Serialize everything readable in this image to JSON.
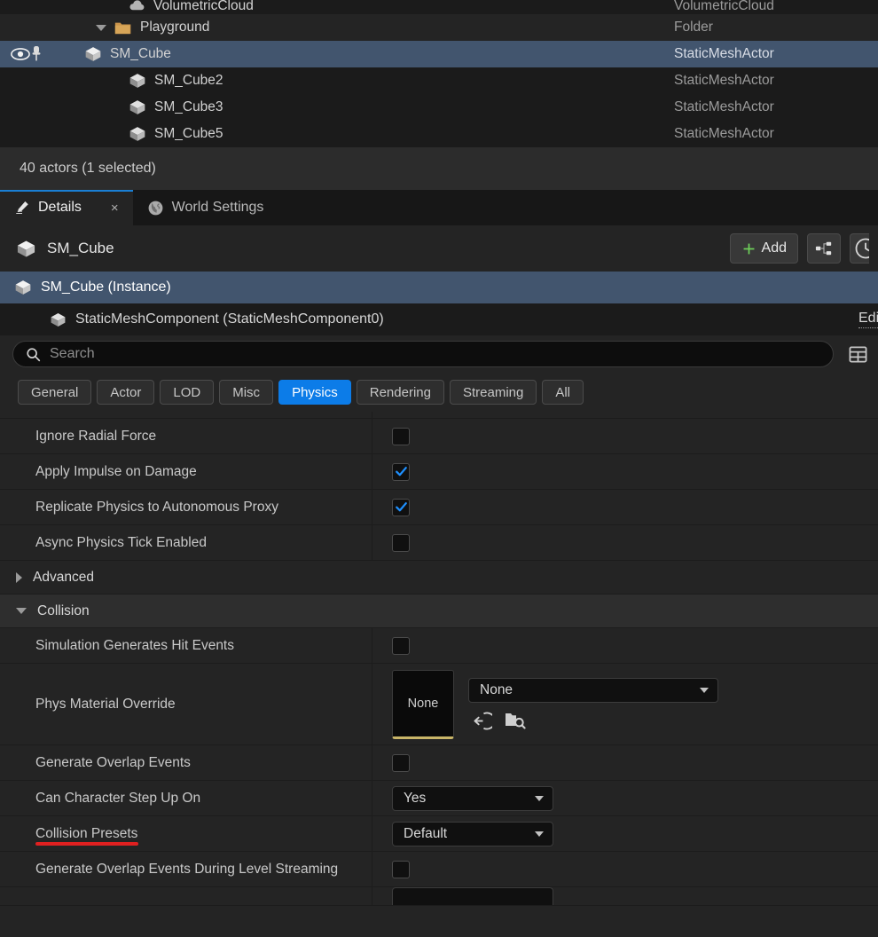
{
  "outliner": {
    "rows": [
      {
        "name": "VolumetricCloud",
        "type": "VolumetricCloud",
        "icon": "cloud-icon",
        "indent": 3,
        "state": "clipped"
      },
      {
        "name": "Playground",
        "type": "Folder",
        "icon": "folder-icon",
        "indent": 2,
        "state": "alt"
      },
      {
        "name": "SM_Cube",
        "type": "StaticMeshActor",
        "icon": "static-mesh-icon",
        "indent": 3,
        "state": "selected"
      },
      {
        "name": "SM_Cube2",
        "type": "StaticMeshActor",
        "icon": "static-mesh-icon",
        "indent": 3,
        "state": "normal"
      },
      {
        "name": "SM_Cube3",
        "type": "StaticMeshActor",
        "icon": "static-mesh-icon",
        "indent": 3,
        "state": "normal"
      },
      {
        "name": "SM_Cube5",
        "type": "StaticMeshActor",
        "icon": "static-mesh-icon",
        "indent": 3,
        "state": "normal"
      }
    ],
    "status": "40 actors (1 selected)"
  },
  "tabs": {
    "details": {
      "label": "Details",
      "icon": "pencil-icon",
      "close": "×"
    },
    "world_settings": {
      "label": "World Settings",
      "icon": "globe-icon"
    }
  },
  "details_header": {
    "title": "SM_Cube",
    "icon": "static-mesh-icon",
    "add_label": "Add",
    "add_icon": "plus-icon",
    "blueprint_icon": "hierarchy-icon",
    "history_icon": "clock-icon"
  },
  "component_tree": {
    "rows": [
      {
        "label": "SM_Cube (Instance)",
        "icon": "static-mesh-icon",
        "selected": true,
        "edit": ""
      },
      {
        "label": "StaticMeshComponent (StaticMeshComponent0)",
        "icon": "static-mesh-icon",
        "selected": false,
        "edit": "Edit"
      }
    ]
  },
  "search": {
    "placeholder": "Search",
    "value": "",
    "icon": "search-icon",
    "settings_icon": "grid-settings-icon"
  },
  "filters": {
    "items": [
      {
        "label": "General",
        "active": false
      },
      {
        "label": "Actor",
        "active": false
      },
      {
        "label": "LOD",
        "active": false
      },
      {
        "label": "Misc",
        "active": false
      },
      {
        "label": "Physics",
        "active": true
      },
      {
        "label": "Rendering",
        "active": false
      },
      {
        "label": "Streaming",
        "active": false
      },
      {
        "label": "All",
        "active": false
      }
    ]
  },
  "properties": [
    {
      "kind": "checkbox",
      "label": "Ignore Radial Force",
      "checked": false
    },
    {
      "kind": "checkbox",
      "label": "Apply Impulse on Damage",
      "checked": true
    },
    {
      "kind": "checkbox",
      "label": "Replicate Physics to Autonomous Proxy",
      "checked": true
    },
    {
      "kind": "checkbox",
      "label": "Async Physics Tick Enabled",
      "checked": false
    },
    {
      "kind": "section",
      "label": "Advanced",
      "expanded": false
    },
    {
      "kind": "section",
      "label": "Collision",
      "expanded": true
    },
    {
      "kind": "checkbox",
      "label": "Simulation Generates Hit Events",
      "checked": false
    },
    {
      "kind": "asset",
      "label": "Phys Material Override",
      "thumb_label": "None",
      "value": "None",
      "use_icon": "use-selected-asset-icon",
      "browse_icon": "browse-asset-icon"
    },
    {
      "kind": "checkbox",
      "label": "Generate Overlap Events",
      "checked": false
    },
    {
      "kind": "dropdown",
      "label": "Can Character Step Up On",
      "value": "Yes",
      "width": 182
    },
    {
      "kind": "dropdown",
      "label": "Collision Presets",
      "value": "Default",
      "width": 182,
      "annotated": true
    },
    {
      "kind": "checkbox",
      "label": "Generate Overlap Events During Level Streaming",
      "checked": false
    }
  ],
  "colors": {
    "selection_blue": "#42556e",
    "accent_blue": "#0c7ce8",
    "tab_accent": "#1a7fd4",
    "annotation_red": "#e02020",
    "thumb_border_yellow": "#c9b568",
    "folder_orange": "#c9934a",
    "plus_green": "#6fd15a"
  }
}
